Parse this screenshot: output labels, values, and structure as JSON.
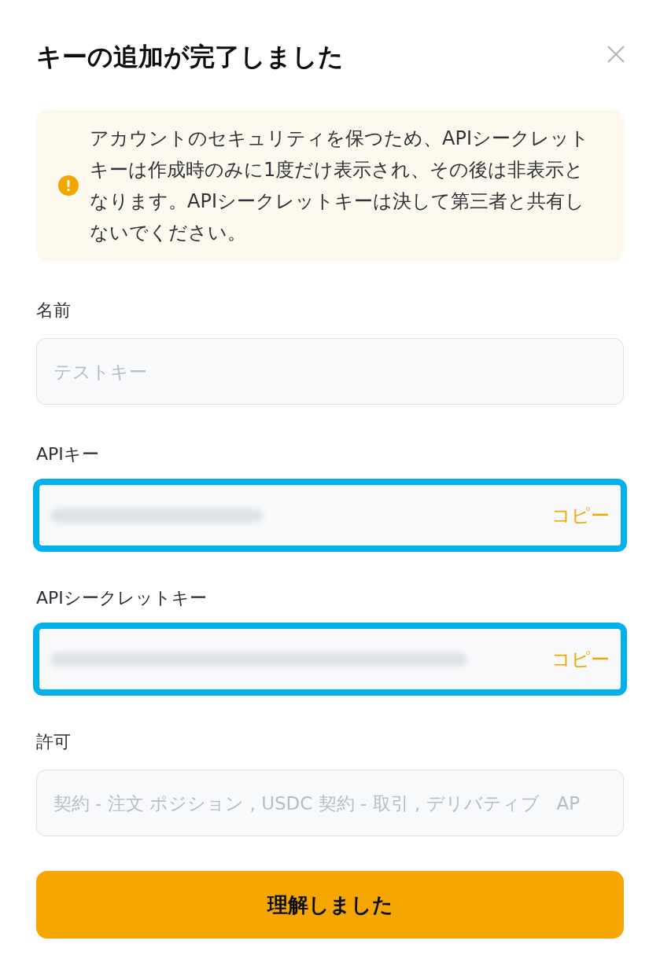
{
  "dialog": {
    "title": "キーの追加が完了しました"
  },
  "notice": {
    "text": "アカウントのセキュリティを保つため、APIシークレットキーは作成時のみに1度だけ表示され、その後は非表示となります。APIシークレットキーは決して第三者と共有しないでください。"
  },
  "fields": [
    {
      "kind": "plain",
      "label": "名前",
      "value": "テストキー",
      "disabled": true,
      "highlighted": false
    },
    {
      "kind": "key",
      "label": "APIキー",
      "copy_label": "コピー",
      "highlighted": true
    },
    {
      "kind": "secret",
      "label": "APIシークレットキー",
      "copy_label": "コピー",
      "highlighted": true
    },
    {
      "kind": "plain",
      "label": "許可",
      "value": "契約 - 注文 ポジション , USDC 契約 - 取引 , デリバティブ   AP",
      "disabled": true,
      "highlighted": false
    }
  ],
  "confirm_button": {
    "label": "理解しました"
  }
}
